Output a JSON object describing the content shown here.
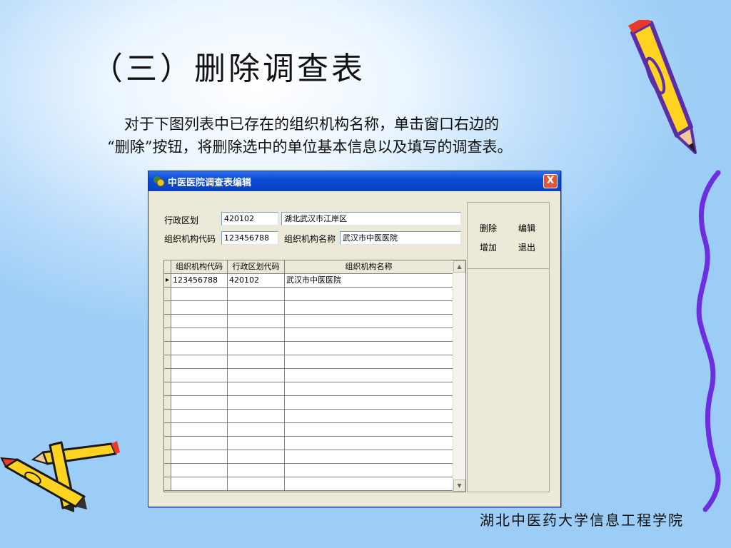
{
  "slide": {
    "title": "（三）删除调查表",
    "desc_line1": "对于下图列表中已存在的组织机构名称，单击窗口右边的",
    "desc_line2": "“删除”按钮，将删除选中的单位基本信息以及填写的调查表。",
    "footer": "湖北中医药大学信息工程学院"
  },
  "window": {
    "title": "中医医院调查表编辑",
    "close_label": "X",
    "form": {
      "region_label": "行政区划",
      "region_code": "420102",
      "region_name": "湖北武汉市江岸区",
      "org_code_label": "组织机构代码",
      "org_code": "123456788",
      "org_name_label": "组织机构名称",
      "org_name": "武汉市中医医院"
    },
    "buttons": {
      "delete": "删除",
      "edit": "编辑",
      "add": "增加",
      "exit": "退出"
    },
    "grid": {
      "columns": [
        "组织机构代码",
        "行政区划代码",
        "组织机构名称"
      ],
      "rows": [
        [
          "123456788",
          "420102",
          "武汉市中医医院"
        ]
      ],
      "current_row_marker": "▸"
    }
  },
  "colors": {
    "titlebar": "#0a4bd6",
    "window_bg": "#ece9d8",
    "pencil_yellow": "#ffd320",
    "pencil_purple": "#5b2ea8"
  }
}
